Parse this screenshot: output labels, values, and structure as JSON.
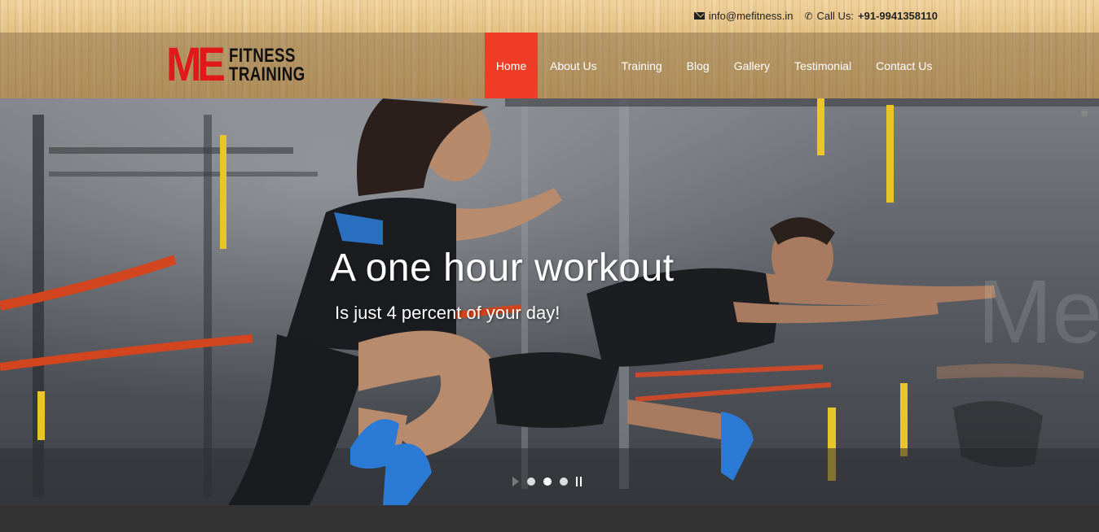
{
  "topbar": {
    "email": "info@mefitness.in",
    "phone_label": "Call Us:",
    "phone_number": "+91-9941358110"
  },
  "logo": {
    "mark": "ME",
    "line1": "FITNESS",
    "line2": "TRAINING"
  },
  "menu": {
    "items": [
      {
        "label": "Home",
        "active": true
      },
      {
        "label": "About Us"
      },
      {
        "label": "Training"
      },
      {
        "label": "Blog"
      },
      {
        "label": "Gallery"
      },
      {
        "label": "Testimonial"
      },
      {
        "label": "Contact Us"
      }
    ]
  },
  "hero": {
    "title": "A one hour workout",
    "subtitle": "Is just 4 percent of your day!",
    "slide_count": 3,
    "active_slide": 2
  },
  "colors": {
    "accent": "#ef3c26",
    "logo_red": "#e01a1a",
    "footer": "#333333"
  }
}
